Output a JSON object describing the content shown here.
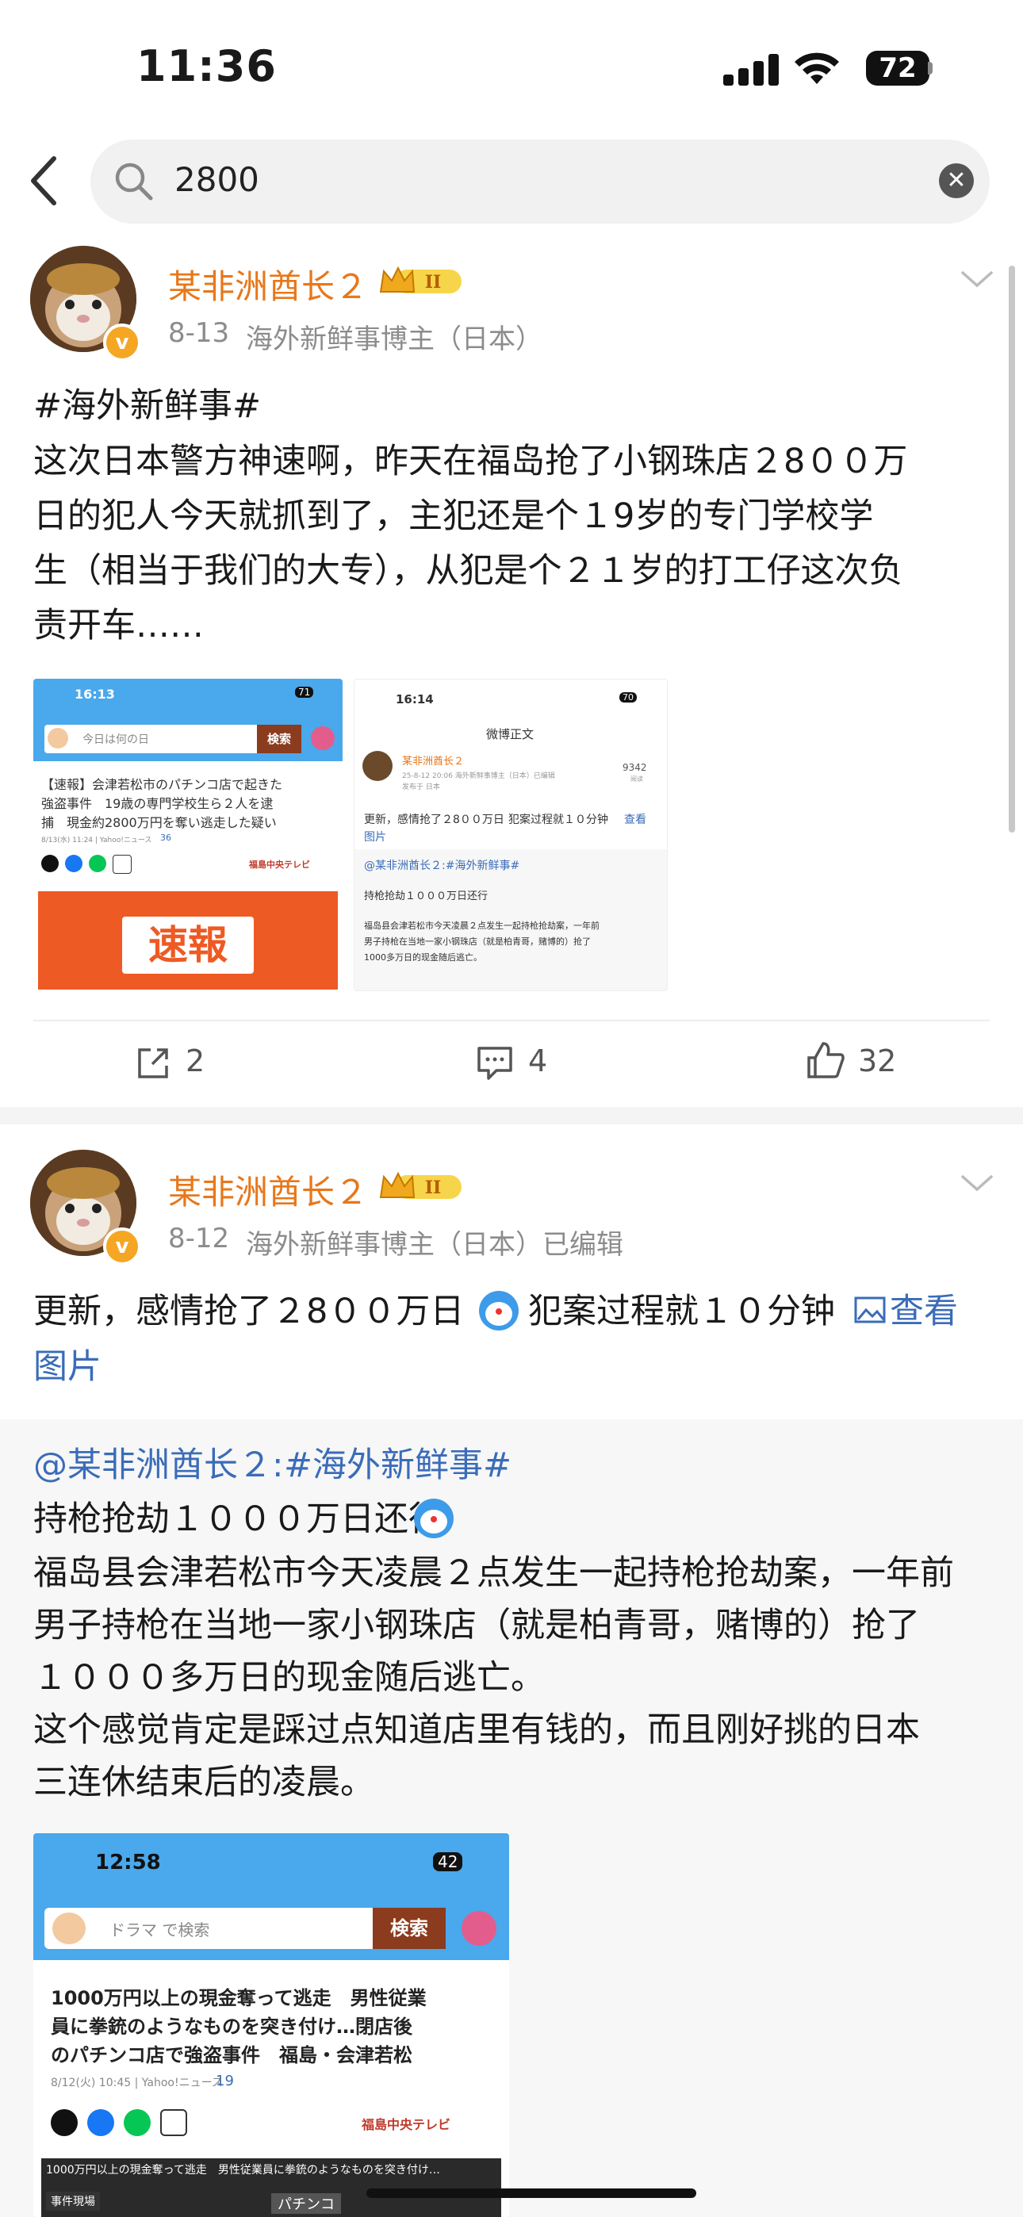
{
  "status": {
    "time": "11:36",
    "battery": "72"
  },
  "search": {
    "query": "2800"
  },
  "post1": {
    "author": "某非洲酋长２",
    "level": "II",
    "date": "8-13",
    "source": "海外新鲜事博主（日本）",
    "hashtag": "#海外新鲜事#",
    "lines": [
      "这次日本警方神速啊，昨天在福岛抢了小钢珠店２8００万",
      "日的犯人今天就抓到了，主犯还是个１9岁的专门学校学",
      "生（相当于我们的大专），从犯是个２１岁的打工仔这次负",
      "责开车……"
    ],
    "img1": {
      "time": "16:13",
      "battery": "71",
      "search_placeholder": "今日は何の日",
      "search_button": "検索",
      "headline1": "【速報】会津若松市のパチンコ店で起きた",
      "headline2": "強盗事件　19歳の専門学校生ら２人を逮",
      "headline3": "捕　現金約2800万円を奪い逃走した疑い",
      "meta": "8/13(水) 11:24 | Yahoo!ニュース",
      "comments": "36",
      "channel": "福島中央テレビ",
      "banner": "速報"
    },
    "img2": {
      "time": "16:14",
      "battery": "70",
      "title": "微博正文",
      "author": "某非洲酋长２",
      "meta": "25-8-12 20:06  海外新鲜事博主（日本）已编辑",
      "meta2": "发布于 日本",
      "count": "9342",
      "count_label": "阅读",
      "text1": "更新，感情抢了２8００万日",
      "text2": "犯案过程就１０分钟",
      "link": "查看",
      "link2": "图片",
      "quote": "@某非洲酋长２:#海外新鲜事#",
      "q1": "持枪抢劫１０００万日还行",
      "q2": "福岛县会津若松市今天凌晨２点发生一起持枪抢劫案，一年前",
      "q3": "男子持枪在当地一家小钢珠店（就是柏青哥，赌博的）抢了",
      "q4": "1000多万日的现金随后逃亡。"
    },
    "reposts": "2",
    "comments": "4",
    "likes": "32"
  },
  "post2": {
    "author": "某非洲酋长２",
    "level": "II",
    "date": "8-12",
    "source": "海外新鲜事博主（日本）已编辑",
    "text_a": "更新，感情抢了２8００万日",
    "text_b": "犯案过程就１０分钟",
    "link_a": "查看",
    "link_b": "图片",
    "quote": {
      "mention": "@某非洲酋长２:",
      "hashtag": "#海外新鲜事#",
      "line1": "持枪抢劫１０００万日还行",
      "lines": [
        "福岛县会津若松市今天凌晨２点发生一起持枪抢劫案，一年前",
        "男子持枪在当地一家小钢珠店（就是柏青哥，赌博的）抢了",
        "１０００多万日的现金随后逃亡。",
        "这个感觉肯定是踩过点知道店里有钱的，而且刚好挑的日本",
        "三连休结束后的凌晨。"
      ]
    },
    "img": {
      "time": "12:58",
      "battery": "42",
      "search_placeholder": "ドラマ で検索",
      "search_button": "検索",
      "headline1": "1000万円以上の現金奪って逃走　男性従業",
      "headline2": "員に拳銃のようなものを突き付け…閉店後",
      "headline3": "のパチンコ店で強盗事件　福島・会津若松",
      "meta": "8/12(火) 10:45 | Yahoo!ニュース",
      "comments": "19",
      "channel": "福島中央テレビ",
      "caption": "1000万円以上の現金奪って逃走　男性従業員に拳銃のようなものを突き付け…",
      "label": "事件現場",
      "sign": "パチンコ"
    }
  },
  "colors": {
    "accent": "#e8771a",
    "link": "#3a6cb8",
    "yahoo_blue": "#3da0ea",
    "news_red": "#ee5a24"
  }
}
